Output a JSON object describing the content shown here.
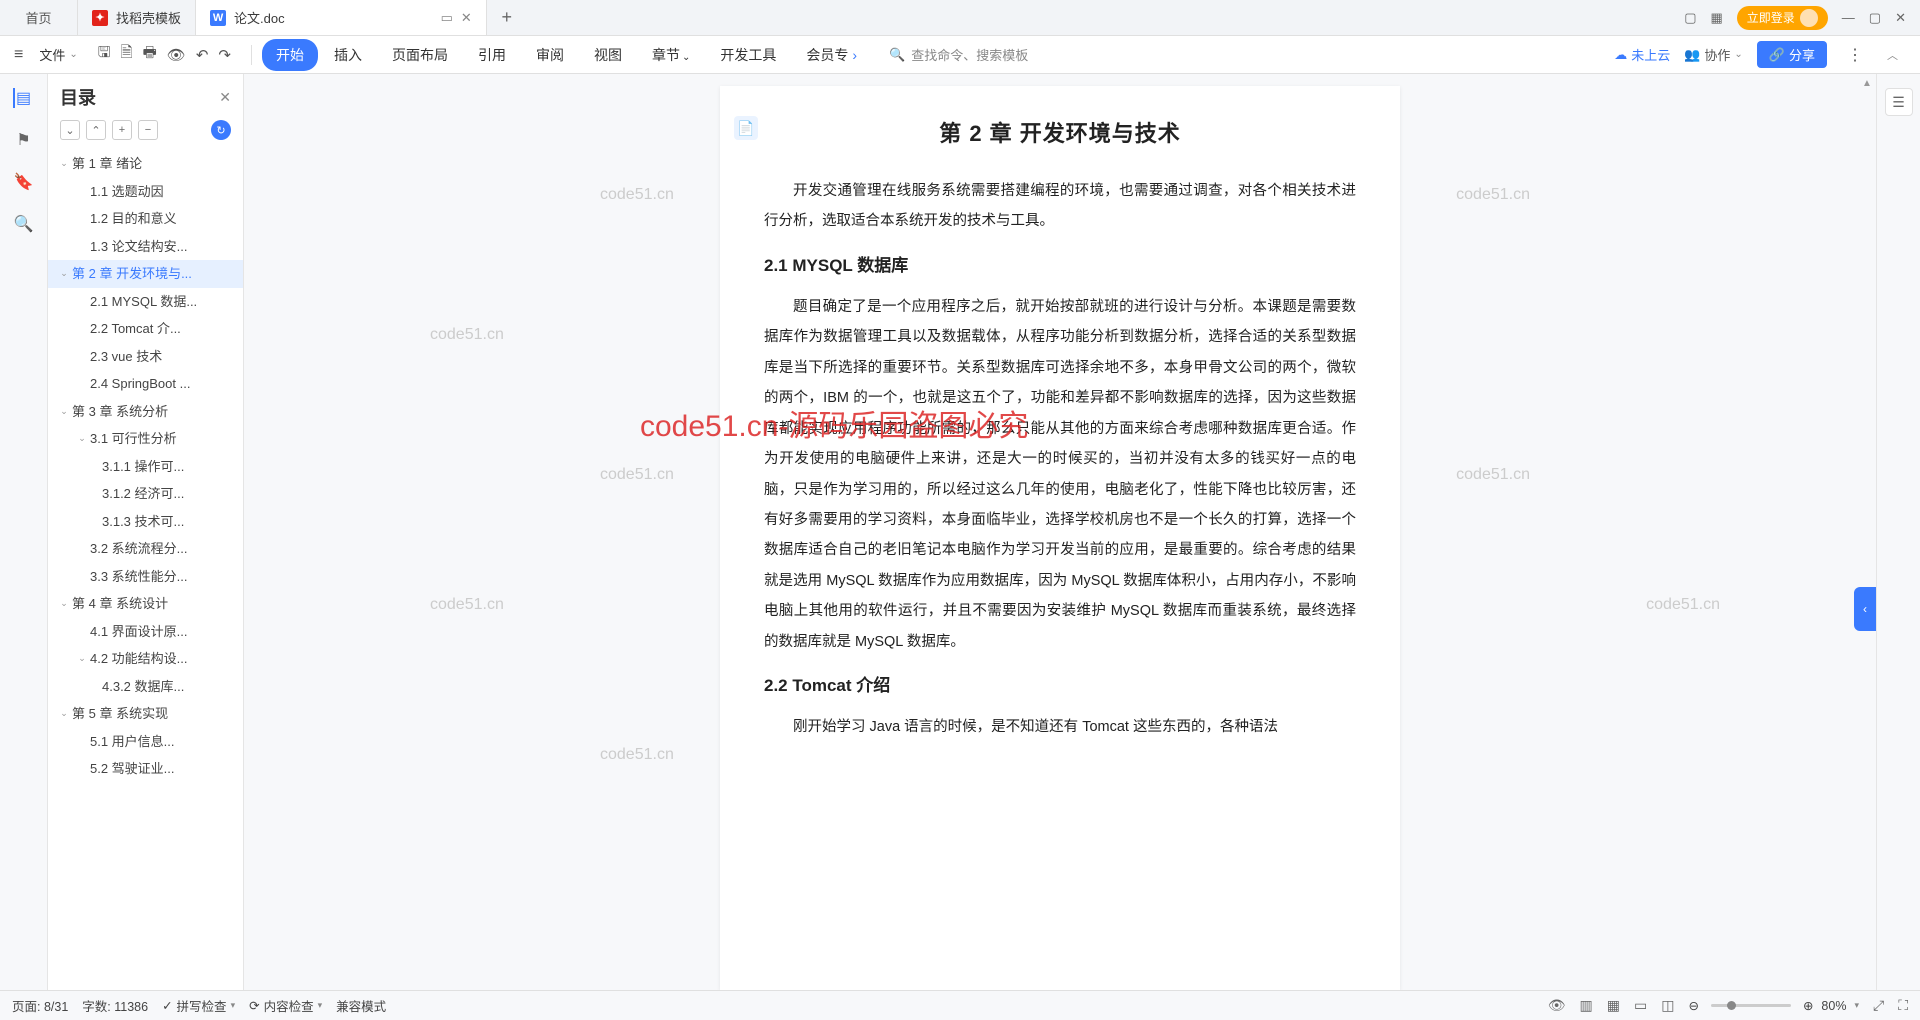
{
  "titlebar": {
    "tabs": [
      {
        "label": "首页",
        "icon": "",
        "active": false
      },
      {
        "label": "找稻壳模板",
        "icon": "W",
        "active": false
      },
      {
        "label": "论文.doc",
        "icon": "W",
        "active": true
      }
    ],
    "login": "立即登录"
  },
  "menubar": {
    "file": "文件",
    "tabs": [
      "开始",
      "插入",
      "页面布局",
      "引用",
      "审阅",
      "视图",
      "章节",
      "开发工具",
      "会员专"
    ],
    "search": "查找命令、搜索模板",
    "cloud": "未上云",
    "collab": "协作",
    "share": "分享"
  },
  "outline": {
    "title": "目录",
    "items": [
      {
        "label": "第 1 章  绪论",
        "level": 1,
        "toggle": true
      },
      {
        "label": "1.1 选题动因",
        "level": 2
      },
      {
        "label": "1.2 目的和意义",
        "level": 2
      },
      {
        "label": "1.3 论文结构安...",
        "level": 2
      },
      {
        "label": "第 2 章  开发环境与...",
        "level": 1,
        "toggle": true,
        "selected": true
      },
      {
        "label": "2.1 MYSQL 数据...",
        "level": 2
      },
      {
        "label": "2.2 Tomcat  介...",
        "level": 2
      },
      {
        "label": "2.3 vue 技术",
        "level": 2
      },
      {
        "label": "2.4 SpringBoot ...",
        "level": 2
      },
      {
        "label": "第 3 章  系统分析",
        "level": 1,
        "toggle": true
      },
      {
        "label": "3.1 可行性分析",
        "level": 2,
        "toggle": true
      },
      {
        "label": "3.1.1 操作可...",
        "level": 3
      },
      {
        "label": "3.1.2 经济可...",
        "level": 3
      },
      {
        "label": "3.1.3 技术可...",
        "level": 3
      },
      {
        "label": "3.2 系统流程分...",
        "level": 2
      },
      {
        "label": "3.3 系统性能分...",
        "level": 2
      },
      {
        "label": "第 4 章  系统设计",
        "level": 1,
        "toggle": true
      },
      {
        "label": "4.1 界面设计原...",
        "level": 2
      },
      {
        "label": "4.2 功能结构设...",
        "level": 2,
        "toggle": true
      },
      {
        "label": "4.3.2  数据库...",
        "level": 3
      },
      {
        "label": "第 5 章  系统实现",
        "level": 1,
        "toggle": true
      },
      {
        "label": "5.1 用户信息...",
        "level": 2
      },
      {
        "label": "5.2 驾驶证业...",
        "level": 2
      }
    ]
  },
  "doc": {
    "chapter_title": "第 2 章  开发环境与技术",
    "intro": "开发交通管理在线服务系统需要搭建编程的环境，也需要通过调查，对各个相关技术进行分析，选取适合本系统开发的技术与工具。",
    "h21": "2.1 MYSQL 数据库",
    "p21": "题目确定了是一个应用程序之后，就开始按部就班的进行设计与分析。本课题是需要数据库作为数据管理工具以及数据载体，从程序功能分析到数据分析，选择合适的关系型数据库是当下所选择的重要环节。关系型数据库可选择余地不多，本身甲骨文公司的两个，微软的两个，IBM 的一个，也就是这五个了，功能和差异都不影响数据库的选择，因为这些数据库都能实现应用程序功能所需的，那么只能从其他的方面来综合考虑哪种数据库更合适。作为开发使用的电脑硬件上来讲，还是大一的时候买的，当初并没有太多的钱买好一点的电脑，只是作为学习用的，所以经过这么几年的使用，电脑老化了，性能下降也比较厉害，还有好多需要用的学习资料，本身面临毕业，选择学校机房也不是一个长久的打算，选择一个数据库适合自己的老旧笔记本电脑作为学习开发当前的应用，是最重要的。综合考虑的结果就是选用 MySQL 数据库作为应用数据库，因为 MySQL 数据库体积小，占用内存小，不影响电脑上其他用的软件运行，并且不需要因为安装维护 MySQL 数据库而重装系统，最终选择的数据库就是 MySQL 数据库。",
    "h22": "2.2 Tomcat  介绍",
    "p22": "刚开始学习 Java 语言的时候，是不知道还有 Tomcat 这些东西的，各种语法"
  },
  "watermarks": {
    "w1": "code51.cn",
    "center": "code51.cn-源码乐园盗图必究"
  },
  "status": {
    "page": "页面: 8/31",
    "words": "字数: 11386",
    "spell": "拼写检查",
    "content": "内容检查",
    "compat": "兼容模式",
    "zoom": "80%"
  }
}
